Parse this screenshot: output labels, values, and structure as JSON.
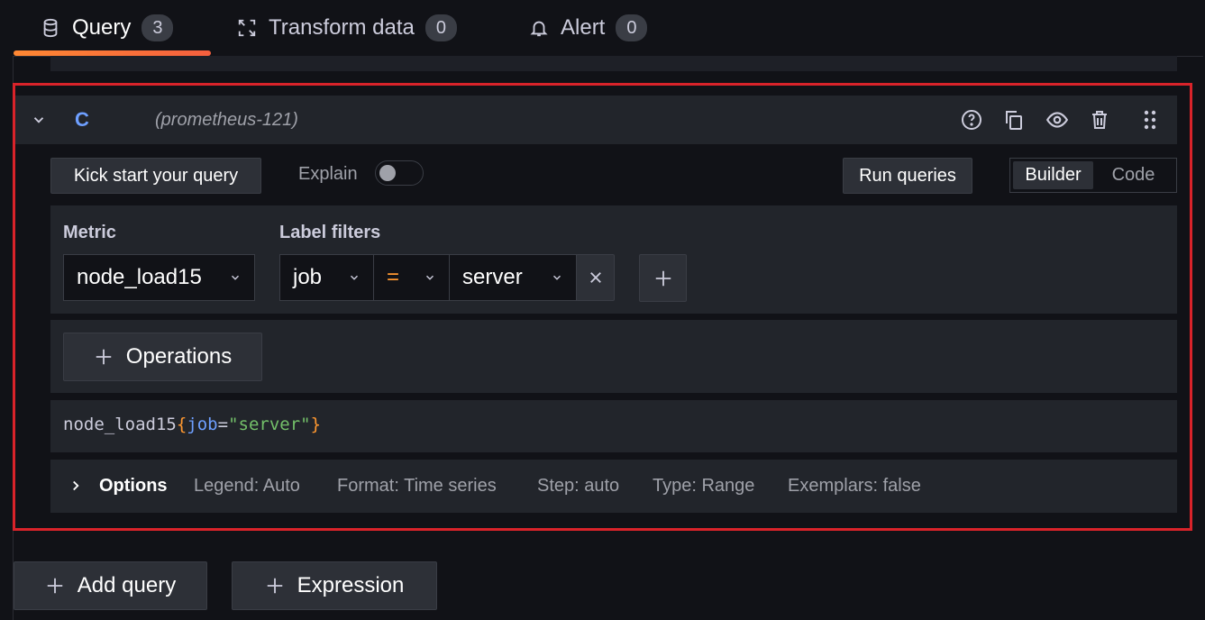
{
  "tabs": [
    {
      "label": "Query",
      "count": "3"
    },
    {
      "label": "Transform data",
      "count": "0"
    },
    {
      "label": "Alert",
      "count": "0"
    }
  ],
  "query": {
    "ref_id": "C",
    "datasource": "(prometheus-121)",
    "kick_start_label": "Kick start your query",
    "explain_label": "Explain",
    "run_queries_label": "Run queries",
    "mode_builder": "Builder",
    "mode_code": "Code",
    "metric_label": "Metric",
    "metric_value": "node_load15",
    "label_filters_label": "Label filters",
    "filter": {
      "label": "job",
      "operator": "=",
      "value": "server"
    },
    "operations_label": "Operations",
    "expression": {
      "metric": "node_load15",
      "open": "{",
      "key": "job",
      "eq": "=",
      "value": "\"server\"",
      "close": "}"
    },
    "options": {
      "title": "Options",
      "legend": "Legend: Auto",
      "format": "Format: Time series",
      "step": "Step: auto",
      "type": "Type: Range",
      "exemplars": "Exemplars: false"
    }
  },
  "actions": {
    "add_query": "Add query",
    "expression": "Expression"
  },
  "colors": {
    "accent": "#ff8833",
    "highlight": "#d9232a",
    "ref_id": "#6e9fff",
    "brace": "#ff9830",
    "string": "#73bf69"
  }
}
